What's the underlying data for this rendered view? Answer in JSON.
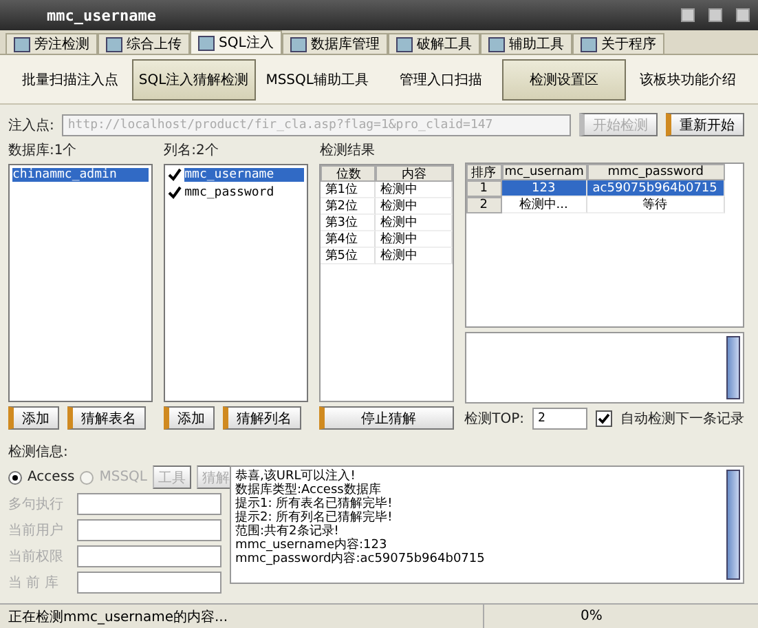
{
  "window": {
    "title": "mmc_username"
  },
  "tabs": [
    {
      "label": "旁注检测",
      "selected": false
    },
    {
      "label": "综合上传",
      "selected": false
    },
    {
      "label": "SQL注入",
      "selected": true
    },
    {
      "label": "数据库管理",
      "selected": false
    },
    {
      "label": "破解工具",
      "selected": false
    },
    {
      "label": "辅助工具",
      "selected": false
    },
    {
      "label": "关于程序",
      "selected": false
    }
  ],
  "subtabs": [
    {
      "label": "批量扫描注入点",
      "selected": false
    },
    {
      "label": "SQL注入猜解检测",
      "selected": true
    },
    {
      "label": "MSSQL辅助工具",
      "selected": false
    },
    {
      "label": "管理入口扫描",
      "selected": false
    },
    {
      "label": "检测设置区",
      "selected": true
    },
    {
      "label": "该板块功能介绍",
      "selected": false
    }
  ],
  "inject": {
    "label": "注入点:",
    "value": "http://localhost/product/fir_cla.asp?flag=1&pro_claid=147",
    "disabled": true,
    "buttons": [
      {
        "label": "开始检测",
        "disabled": true
      },
      {
        "label": "重新开始",
        "disabled": false
      }
    ]
  },
  "databases": {
    "label": "数据库:1个",
    "items": [
      {
        "name": "chinammc_admin",
        "selected": true
      }
    ],
    "buttons": [
      "添加",
      "猜解表名"
    ]
  },
  "columns": {
    "label": "列名:2个",
    "items": [
      {
        "name": "mmc_username",
        "checked": true,
        "selected": true
      },
      {
        "name": "mmc_password",
        "checked": true,
        "selected": false
      }
    ],
    "buttons": [
      "添加",
      "猜解列名"
    ]
  },
  "results": {
    "label": "检测结果",
    "columns": [
      "位数",
      "内容"
    ],
    "rows": [
      [
        "第1位",
        "检测中"
      ],
      [
        "第2位",
        "检测中"
      ],
      [
        "第3位",
        "检测中"
      ],
      [
        "第4位",
        "检测中"
      ],
      [
        "第5位",
        "检测中"
      ]
    ],
    "stop_button": "停止猜解"
  },
  "records": {
    "columns": [
      "排序",
      "mc_usernam",
      "mmc_password"
    ],
    "rows": [
      {
        "cells": [
          "1",
          "123",
          "ac59075b964b0715"
        ],
        "selected": true
      },
      {
        "cells": [
          "2",
          "检测中...",
          "等待"
        ],
        "selected": false
      }
    ]
  },
  "top": {
    "label": "检测TOP:",
    "value": "2"
  },
  "auto": {
    "label": "自动检测下一条记录",
    "checked": true
  },
  "info": {
    "label": "检测信息:",
    "radios": [
      {
        "label": "Access",
        "selected": true,
        "disabled": false
      },
      {
        "label": "MSSQL",
        "selected": false,
        "disabled": true
      }
    ],
    "buttons": [
      {
        "label": "工具",
        "disabled": true
      },
      {
        "label": "猜解",
        "disabled": true
      }
    ],
    "fields": [
      {
        "label": "多句执行",
        "disabled": true
      },
      {
        "label": "当前用户",
        "disabled": true
      },
      {
        "label": "当前权限",
        "disabled": true
      },
      {
        "label": "当 前 库",
        "disabled": true
      }
    ],
    "log": [
      "恭喜,该URL可以注入!",
      "数据库类型:Access数据库",
      "提示1: 所有表名已猜解完毕!",
      "提示2: 所有列名已猜解完毕!",
      "范围:共有2条记录!",
      "mmc_username内容:123",
      "mmc_password内容:ac59075b964b0715"
    ]
  },
  "status": {
    "text": "正在检测mmc_username的内容...",
    "progress": "0%"
  }
}
